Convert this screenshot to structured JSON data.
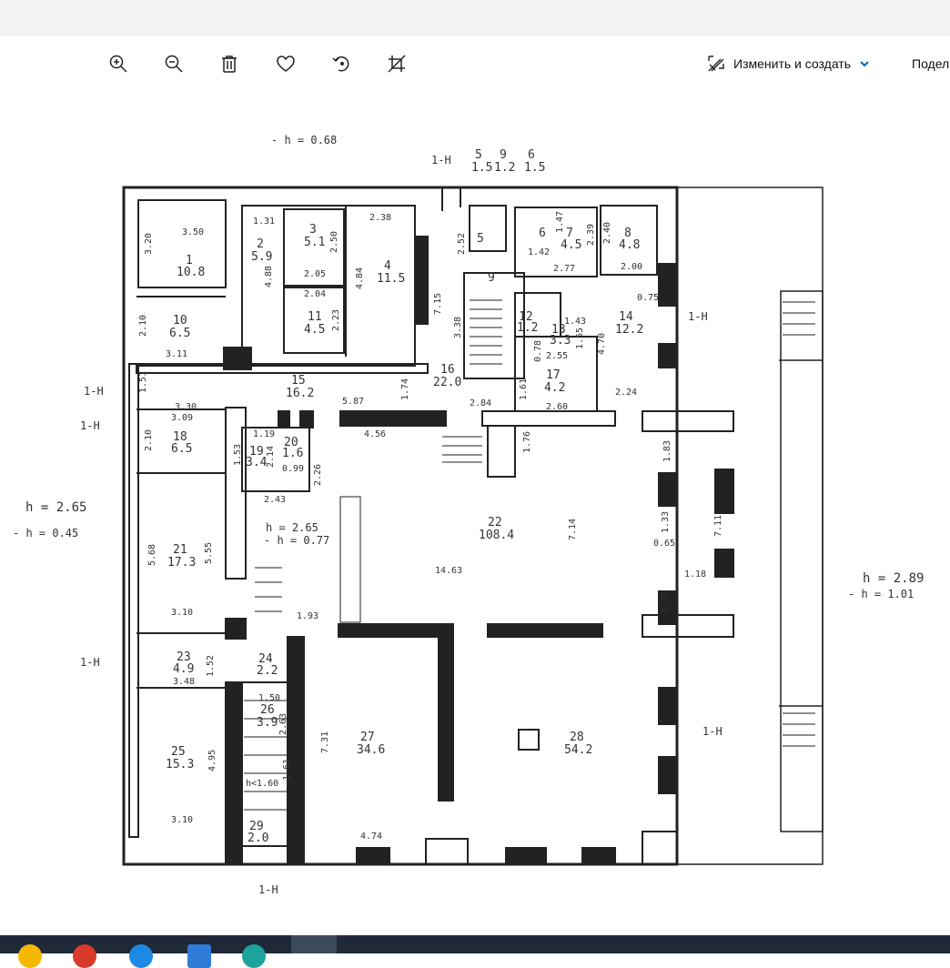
{
  "toolbar": {
    "edit_label": "Изменить и создать",
    "share_label": "Поделиться",
    "icons": [
      "zoom-in-icon",
      "zoom-out-icon",
      "delete-icon",
      "favorite-icon",
      "rotate-icon",
      "crop-icon",
      "edit-create-icon",
      "chevron-down-icon",
      "share-icon"
    ],
    "accent": "#0067c0"
  },
  "plan": {
    "top_note": "- h = 0.68",
    "left_note_1": "h = 2.65",
    "left_note_2": "- h = 0.45",
    "right_note_1": "h = 2.89",
    "right_note_2": "- h = 1.01",
    "center_note_1": "h = 2.65",
    "center_note_2": "- h = 0.77",
    "stair_note": "h<1.60",
    "section_labels": [
      "1-H",
      "1-H",
      "1-H",
      "1-H",
      "1-H",
      "1-H",
      "1-H"
    ],
    "rooms": [
      {
        "num": "1",
        "area": "10.8"
      },
      {
        "num": "2",
        "area": "5.9"
      },
      {
        "num": "3",
        "area": "5.1"
      },
      {
        "num": "4",
        "area": "11.5"
      },
      {
        "num": "5",
        "area": "1.5"
      },
      {
        "num": "6",
        "area": "1.5"
      },
      {
        "num": "7",
        "area": "4.5"
      },
      {
        "num": "8",
        "area": "4.8"
      },
      {
        "num": "9",
        "area": "1.2"
      },
      {
        "num": "10",
        "area": "6.5"
      },
      {
        "num": "11",
        "area": "4.5"
      },
      {
        "num": "12",
        "area": "1.2"
      },
      {
        "num": "13",
        "area": "3.3"
      },
      {
        "num": "14",
        "area": "12.2"
      },
      {
        "num": "15",
        "area": "16.2"
      },
      {
        "num": "16",
        "area": "22.0"
      },
      {
        "num": "17",
        "area": "4.2"
      },
      {
        "num": "18",
        "area": "6.5"
      },
      {
        "num": "19",
        "area": "3.4"
      },
      {
        "num": "20",
        "area": "1.6"
      },
      {
        "num": "21",
        "area": "17.3"
      },
      {
        "num": "22",
        "area": "108.4"
      },
      {
        "num": "23",
        "area": "4.9"
      },
      {
        "num": "24",
        "area": "2.2"
      },
      {
        "num": "25",
        "area": "15.3"
      },
      {
        "num": "26",
        "area": "3.9"
      },
      {
        "num": "27",
        "area": "34.6"
      },
      {
        "num": "28",
        "area": "54.2"
      },
      {
        "num": "29",
        "area": "2.0"
      }
    ],
    "top_rooms": [
      {
        "num": "5",
        "area": "1.5"
      },
      {
        "num": "9",
        "area": "1.2"
      },
      {
        "num": "6",
        "area": "1.5"
      }
    ],
    "dims": [
      "3.50",
      "3.20",
      "1.31",
      "2.38",
      "2.50",
      "2.05",
      "4.88",
      "4.84",
      "2.04",
      "2.23",
      "2.52",
      "7.15",
      "3.38",
      "1.42",
      "2.77",
      "2.00",
      "0.75",
      "2.39",
      "2.40",
      "2.10",
      "3.11",
      "1.51",
      "3.30",
      "3.09",
      "2.10",
      "1.74",
      "5.87",
      "1.61",
      "2.84",
      "4.70",
      "2.55",
      "2.60",
      "2.24",
      "1.43",
      "4.56",
      "1.19",
      "2.14",
      "1.53",
      "0.99",
      "2.26",
      "2.43",
      "1.76",
      "1.83",
      "7.14",
      "7.11",
      "1.33",
      "0.65",
      "1.18",
      "1.77",
      "5.68",
      "5.55",
      "14.63",
      "3.10",
      "1.93",
      "1.52",
      "3.48",
      "1.50",
      "2.63",
      "4.95",
      "7.31",
      "1.61",
      "3.10",
      "4.74",
      "1.55",
      "0.78",
      "1.47"
    ]
  }
}
